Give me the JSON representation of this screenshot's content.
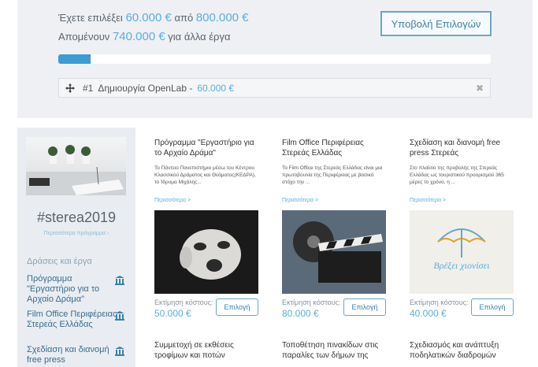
{
  "summary": {
    "line1_prefix": "Έχετε επιλέξει",
    "selected_amount": "60.000 €",
    "line1_mid": "από",
    "total_amount": "800.000 €",
    "line2_prefix": "Απομένουν",
    "remaining_amount": "740.000 €",
    "line2_suffix": "για άλλα έργα",
    "submit_label": "Υποβολή Επιλογών",
    "progress_fraction": 0.075
  },
  "selected": {
    "number": "#1",
    "name": "Δημιουργία OpenLab -",
    "amount": "60.000 €",
    "close": "✖"
  },
  "sidebar": {
    "hashtag": "#sterea2019",
    "link": "Περισσότερα πρόγραμμα ›",
    "heading": "Δράσεις και έργα",
    "items": [
      {
        "label": "Πρόγραμμα \"Εργαστήριο για το Αρχαίο Δράμα\""
      },
      {
        "label": "Film Office Περιφέρειας Στερεάς Ελλάδας"
      },
      {
        "label": "Σχεδίαση και διανομή free press"
      }
    ]
  },
  "cards": [
    {
      "title": "Πρόγραμμα \"Εργαστήριο για το Αρχαίο Δράμα\"",
      "desc": "Το Πάντειο Πανεπιστήμιο μέσω του Κέντρου Κλασσικού Δράματος και Θεάματος(ΚΕΔΡΑ), το Ίδρυμα Μιχάλης...",
      "more": "Περισσότερα >",
      "cost_label": "Εκτίμηση κόστους:",
      "cost": "50.000 €",
      "button": "Επιλογή"
    },
    {
      "title": "Film Office Περιφέρειας Στερεάς Ελλάδας",
      "desc": "Το Film Office της Στερεάς Ελλάδας είναι μια πρωτοβουλία της Περιφέρειας με βασικό στόχο την ...",
      "more": "Περισσότερα >",
      "cost_label": "Εκτίμηση κόστους:",
      "cost": "80.000 €",
      "button": "Επιλογή"
    },
    {
      "title": "Σχεδίαση και διανομή free press Στερεάς",
      "desc": "Στο πλαίσιο της προβολής της Στερεάς Ελλάδας ως τουριστικού προορισμού 365 μέρες το χρόνο, η ...",
      "more": "Περισσότερα >",
      "cost_label": "Εκτίμηση κόστους:",
      "cost": "40.000 €",
      "button": "Επιλογή",
      "image_text": "Βρέξει χιονίσει"
    }
  ],
  "cards_row2": [
    {
      "title": "Συμμετοχή σε εκθέσεις τροφίμων και ποτών"
    },
    {
      "title": "Τοποθέτηση πινακίδων στις παραλίες των δήμων της"
    },
    {
      "title": "Σχεδιασμός και ανάπτυξη ποδηλατικών διαδρομών"
    }
  ]
}
